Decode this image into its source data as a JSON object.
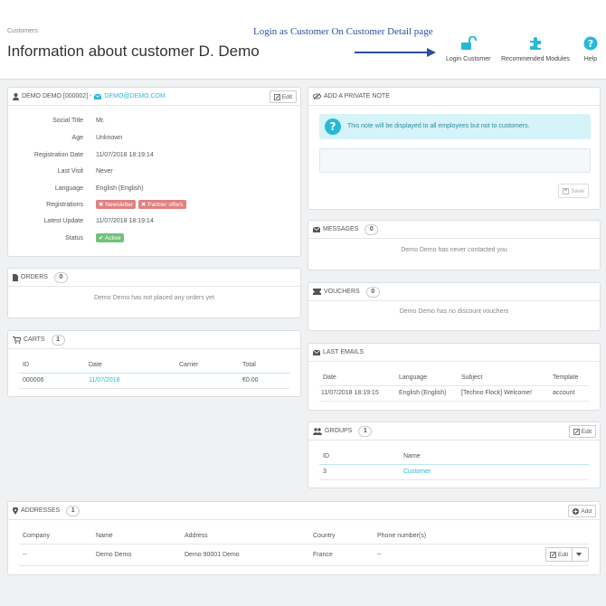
{
  "header": {
    "breadcrumb": "Customers",
    "title": "Information about customer D. Demo",
    "annotation": "Login as Customer On Customer Detail page",
    "toolbar": [
      {
        "label": "Login Customer",
        "icon": "unlock-icon"
      },
      {
        "label": "Recommended Modules",
        "icon": "puzzle-icon"
      },
      {
        "label": "Help",
        "icon": "help-icon"
      }
    ]
  },
  "customer": {
    "name": "DEMO DEMO [000002] -",
    "email": "DEMO@DEMO.COM",
    "edit_label": "Edit",
    "rows": [
      {
        "label": "Social Title",
        "value": "Mr."
      },
      {
        "label": "Age",
        "value": "Unknown"
      },
      {
        "label": "Registration Date",
        "value": "11/07/2018 18:19:14"
      },
      {
        "label": "Last Visit",
        "value": "Never"
      },
      {
        "label": "Language",
        "value": "English (English)"
      },
      {
        "label": "Registrations",
        "value": ""
      },
      {
        "label": "Latest Update",
        "value": "11/07/2018 18:19:14"
      },
      {
        "label": "Status",
        "value": ""
      }
    ],
    "newsletter_tag": "Newsletter",
    "partner_tag": "Partner offers",
    "status_tag": "Active"
  },
  "orders": {
    "title": "ORDERS",
    "count": "0",
    "empty": "Demo Demo has not placed any orders yet"
  },
  "carts": {
    "title": "CARTS",
    "count": "1",
    "headers": [
      "ID",
      "Date",
      "Carrier",
      "Total"
    ],
    "row": [
      "000006",
      "11/07/2018",
      "",
      "€0.00"
    ]
  },
  "note": {
    "title": "ADD A PRIVATE NOTE",
    "info": "This note will be displayed to all employees but not to customers.",
    "save_label": "Save"
  },
  "messages": {
    "title": "MESSAGES",
    "count": "0",
    "empty": "Demo Demo has never contacted you"
  },
  "vouchers": {
    "title": "VOUCHERS",
    "count": "0",
    "empty": "Demo Demo has no discount vouchers"
  },
  "emails": {
    "title": "LAST EMAILS",
    "headers": [
      "Date",
      "Language",
      "Subject",
      "Template"
    ],
    "row": [
      "11/07/2018 18:19:15",
      "English (English)",
      "[Techno Flock] Welcome!",
      "account"
    ]
  },
  "groups": {
    "title": "GROUPS",
    "count": "1",
    "edit_label": "Edit",
    "headers": [
      "ID",
      "Name"
    ],
    "row": [
      "3",
      "Customer"
    ]
  },
  "addresses": {
    "title": "ADDRESSES",
    "count": "1",
    "add_label": "Add",
    "headers": [
      "Company",
      "Name",
      "Address",
      "Country",
      "Phone number(s)"
    ],
    "row": [
      "--",
      "Demo Demo",
      "Demo 90001 Demo",
      "France",
      "--"
    ],
    "edit_label": "Edit"
  },
  "colors": {
    "accent": "#25b9d7",
    "annotation": "#2a4f9e",
    "success": "#72c279",
    "danger": "#e08080"
  }
}
